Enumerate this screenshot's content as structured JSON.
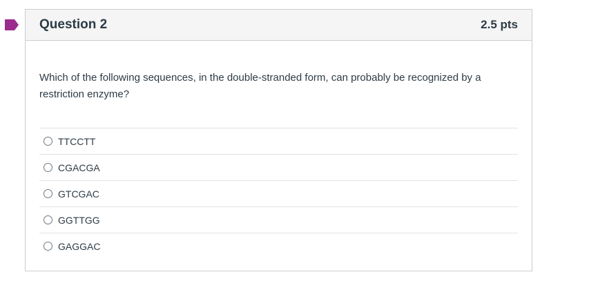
{
  "question": {
    "title": "Question 2",
    "points": "2.5 pts",
    "text": "Which of the following sequences, in the double-stranded form, can probably be recognized by a restriction enzyme?",
    "answers": [
      {
        "label": "TTCCTT"
      },
      {
        "label": "CGACGA"
      },
      {
        "label": "GTCGAC"
      },
      {
        "label": "GGTTGG"
      },
      {
        "label": "GAGGAC"
      }
    ]
  },
  "flag": {
    "icon": "flag-icon",
    "color": "#9c2b8e"
  }
}
